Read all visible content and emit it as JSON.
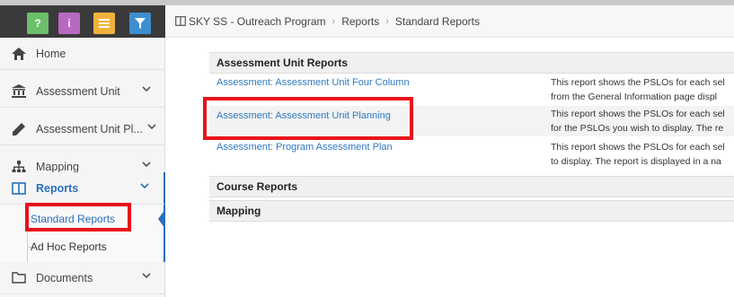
{
  "quick_actions": [
    {
      "label": "?",
      "color": "#6cbf6a"
    },
    {
      "label": "i",
      "color": "#b86ac2"
    },
    {
      "label": "",
      "icon": "list-icon",
      "color": "#f1b23c"
    },
    {
      "label": "",
      "icon": "filter-icon",
      "color": "#3d8fd1"
    }
  ],
  "sidebar": {
    "items": [
      {
        "label": "Home",
        "icon": "home-icon"
      },
      {
        "label": "Assessment Unit",
        "icon": "institution-icon"
      },
      {
        "label": "Assessment Unit Pl...",
        "icon": "pencil-icon"
      },
      {
        "label": "Mapping",
        "icon": "sitemap-icon"
      },
      {
        "label": "Reports",
        "icon": "book-icon"
      },
      {
        "label": "Documents",
        "icon": "folder-icon"
      }
    ],
    "sub_items": [
      {
        "label": "Standard Reports"
      },
      {
        "label": "Ad Hoc Reports"
      }
    ]
  },
  "breadcrumb": {
    "root": "SKY SS - Outreach Program",
    "level2": "Reports",
    "level3": "Standard Reports"
  },
  "reports": {
    "section1": "Assessment Unit Reports",
    "rows": [
      {
        "link": "Assessment: Assessment Unit Four Column",
        "desc1": "This report shows the PSLOs for each sel",
        "desc2": "from the General Information page displ"
      },
      {
        "link": "Assessment: Assessment Unit Planning",
        "desc1": "This report shows the PSLOs for each sel",
        "desc2": "for the PSLOs you wish to display. The re"
      },
      {
        "link": "Assessment: Program Assessment Plan",
        "desc1": "This report shows the PSLOs for each sel",
        "desc2": "to display. The report is displayed in a na"
      }
    ],
    "section2": "Course Reports",
    "section3": "Mapping"
  },
  "colors": {
    "accent": "#2a6ebb",
    "link": "#2f78c4",
    "highlight": "#e8121c"
  }
}
